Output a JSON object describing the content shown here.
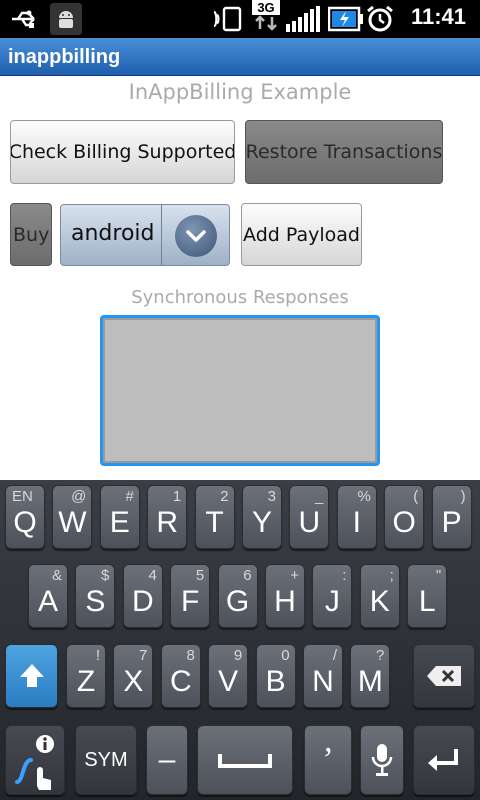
{
  "status_bar": {
    "time": "11:41",
    "icons": [
      "usb-icon",
      "android-debug-icon",
      "sim-icon",
      "3g-icon",
      "signal-icon",
      "battery-charging-icon",
      "alarm-icon"
    ]
  },
  "title_bar": {
    "title": "inappbilling"
  },
  "main": {
    "heading": "InAppBilling Example",
    "check_billing_label": "Check Billing Supported",
    "restore_label": "Restore Transactions",
    "buy_label": "Buy",
    "product_spinner_value": "android",
    "add_payload_label": "Add Payload",
    "sync_label": "Synchronous Responses"
  },
  "keyboard": {
    "row1": [
      {
        "main": "Q",
        "sub": "",
        "subl": "EN"
      },
      {
        "main": "W",
        "sub": "@"
      },
      {
        "main": "E",
        "sub": "#"
      },
      {
        "main": "R",
        "sub": "1"
      },
      {
        "main": "T",
        "sub": "2"
      },
      {
        "main": "Y",
        "sub": "3"
      },
      {
        "main": "U",
        "sub": "_"
      },
      {
        "main": "I",
        "sub": "%"
      },
      {
        "main": "O",
        "sub": "("
      },
      {
        "main": "P",
        "sub": ")"
      }
    ],
    "row2": [
      {
        "main": "A",
        "sub": "&"
      },
      {
        "main": "S",
        "sub": "$"
      },
      {
        "main": "D",
        "sub": "4"
      },
      {
        "main": "F",
        "sub": "5"
      },
      {
        "main": "G",
        "sub": "6"
      },
      {
        "main": "H",
        "sub": "+"
      },
      {
        "main": "J",
        "sub": ":"
      },
      {
        "main": "K",
        "sub": ";"
      },
      {
        "main": "L",
        "sub": "\""
      }
    ],
    "row3": [
      {
        "main": "Z",
        "sub": "!"
      },
      {
        "main": "X",
        "sub": "7"
      },
      {
        "main": "C",
        "sub": "8"
      },
      {
        "main": "V",
        "sub": "9"
      },
      {
        "main": "B",
        "sub": "0"
      },
      {
        "main": "N",
        "sub": "/"
      },
      {
        "main": "M",
        "sub": "?"
      }
    ],
    "sym_label": "SYM",
    "dash_label": "–",
    "quote_label": "’"
  }
}
